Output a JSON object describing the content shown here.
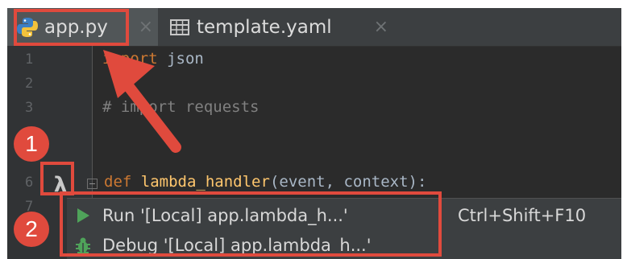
{
  "tabs": [
    {
      "label": "app.py",
      "icon": "python-file-icon",
      "active": true
    },
    {
      "label": "template.yaml",
      "icon": "table-file-icon",
      "active": false
    }
  ],
  "close_glyph": "×",
  "editor": {
    "line_numbers": [
      "1",
      "2",
      "3",
      "6",
      "7"
    ],
    "lines": {
      "l1_kw": "import",
      "l1_rest": " json",
      "l3_comment": "# import requests",
      "l6_kw": "def",
      "l6_fn": "lambda_handler",
      "l6_rest": "(event, context):"
    }
  },
  "gutter_action_icon": "lambda-icon",
  "gutter_action_glyph": "λ",
  "popup_menu": {
    "items": [
      {
        "label": "Run '[Local] app.lambda_h...'",
        "icon": "run-icon",
        "shortcut": "Ctrl+Shift+F10"
      },
      {
        "label": "Debug '[Local] app.lambda_h...'",
        "icon": "debug-icon",
        "shortcut": ""
      }
    ]
  },
  "annotations": {
    "badges": [
      "1",
      "2"
    ],
    "accent_color": "#e04a3d"
  }
}
